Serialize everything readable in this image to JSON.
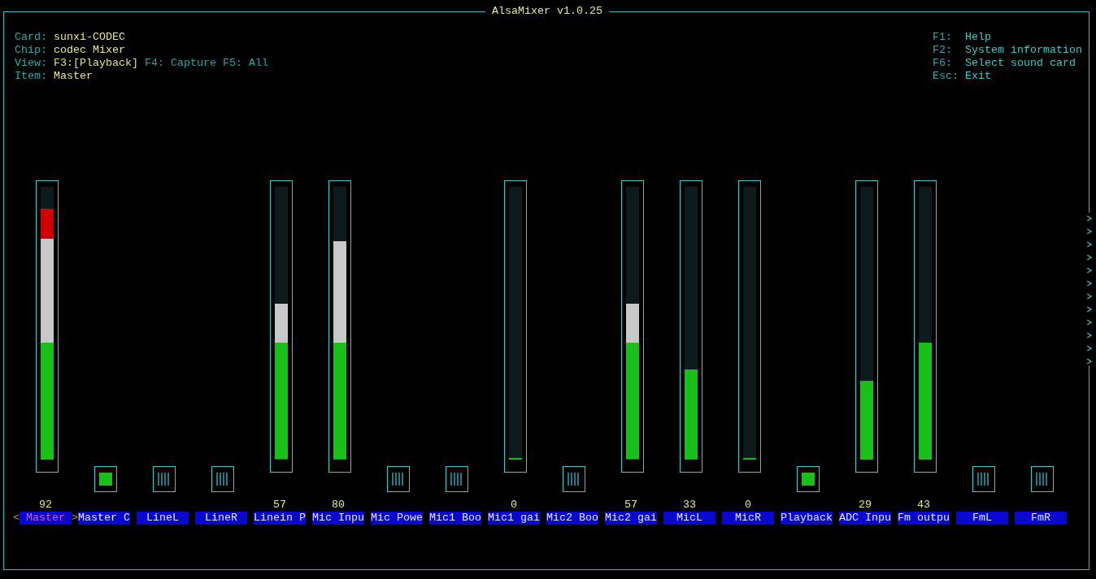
{
  "window": {
    "title": "AlsaMixer v1.0.25"
  },
  "info": [
    {
      "label": "Card:",
      "value": "sunxi-CODEC"
    },
    {
      "label": "Chip:",
      "value": "codec Mixer"
    },
    {
      "label": "View:",
      "views": [
        {
          "text": "F3:[Playback]",
          "selected": true
        },
        {
          "text": "F4: Capture",
          "selected": false
        },
        {
          "text": "F5: All",
          "selected": false
        }
      ]
    },
    {
      "label": "Item:",
      "value": "Master"
    }
  ],
  "help": [
    {
      "key": "F1:",
      "action": "Help"
    },
    {
      "key": "F2:",
      "action": "System information"
    },
    {
      "key": "F6:",
      "action": "Select sound card"
    },
    {
      "key": "Esc:",
      "action": "Exit"
    }
  ],
  "selection_markers": {
    "left": "<",
    "right": ">"
  },
  "controls": [
    {
      "name": "Master",
      "selected": true,
      "kind": "slider",
      "level": 0.92,
      "value": "92"
    },
    {
      "name": "Master C",
      "selected": false,
      "kind": "switch",
      "on": true
    },
    {
      "name": "LineL",
      "selected": false,
      "kind": "switch",
      "on": false
    },
    {
      "name": "LineR",
      "selected": false,
      "kind": "switch",
      "on": false
    },
    {
      "name": "Linein P",
      "selected": false,
      "kind": "slider",
      "level": 0.57,
      "value": "57"
    },
    {
      "name": "Mic Inpu",
      "selected": false,
      "kind": "slider",
      "level": 0.8,
      "value": "80"
    },
    {
      "name": "Mic Powe",
      "selected": false,
      "kind": "switch",
      "on": false
    },
    {
      "name": "Mic1 Boo",
      "selected": false,
      "kind": "switch",
      "on": false
    },
    {
      "name": "Mic1 gai",
      "selected": false,
      "kind": "slider",
      "level": 0,
      "value": "0"
    },
    {
      "name": "Mic2 Boo",
      "selected": false,
      "kind": "switch",
      "on": false
    },
    {
      "name": "Mic2 gai",
      "selected": false,
      "kind": "slider",
      "level": 0.57,
      "value": "57"
    },
    {
      "name": "MicL",
      "selected": false,
      "kind": "slider",
      "level": 0.33,
      "value": "33"
    },
    {
      "name": "MicR",
      "selected": false,
      "kind": "slider",
      "level": 0,
      "value": "0"
    },
    {
      "name": "Playback",
      "selected": false,
      "kind": "switch",
      "on": true
    },
    {
      "name": "ADC Inpu",
      "selected": false,
      "kind": "slider",
      "level": 0.29,
      "value": "29"
    },
    {
      "name": "Fm outpu",
      "selected": false,
      "kind": "slider",
      "level": 0.43,
      "value": "43"
    },
    {
      "name": "FmL",
      "selected": false,
      "kind": "switch",
      "on": false
    },
    {
      "name": "FmR",
      "selected": false,
      "kind": "switch",
      "on": false
    }
  ]
}
